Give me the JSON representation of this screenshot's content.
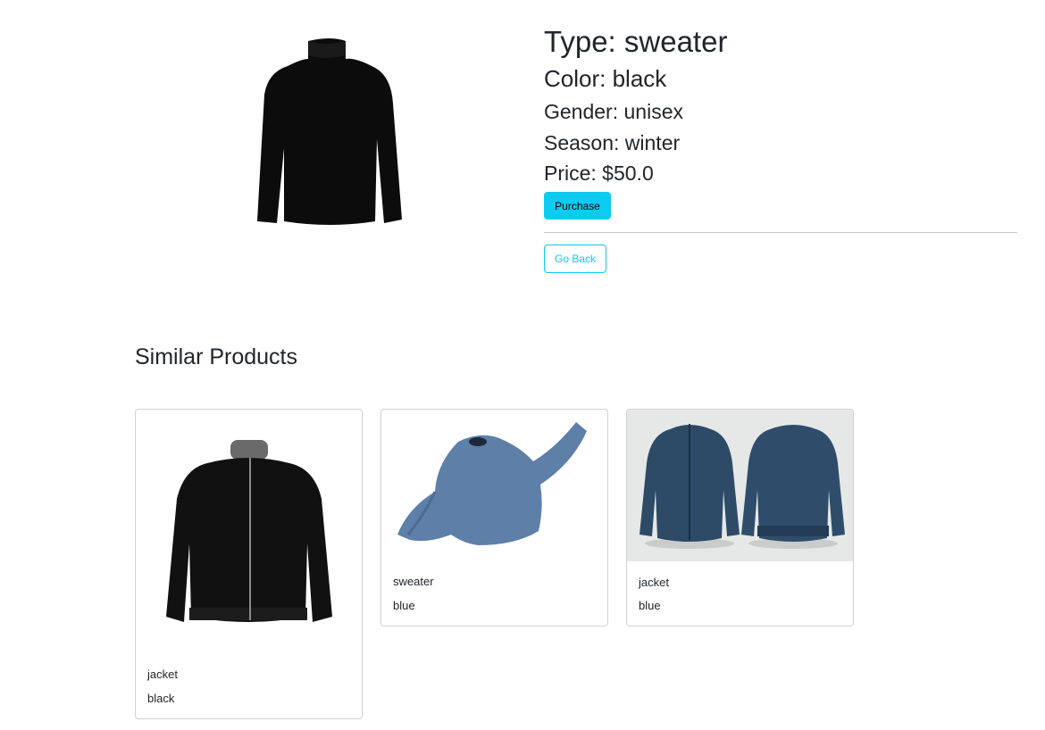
{
  "product": {
    "image_icon": "black-turtleneck-sweater",
    "type": "Type: sweater",
    "color": "Color: black",
    "gender": "Gender: unisex",
    "season": "Season: winter",
    "price": "Price: $50.0"
  },
  "actions": {
    "purchase_label": "Purchase",
    "back_label": "Go Back"
  },
  "colors": {
    "accent": "#0dcaf0",
    "text": "#212529",
    "border": "#d0d0d0"
  },
  "similar": {
    "title": "Similar Products",
    "items": [
      {
        "type": "jacket",
        "color": "black",
        "image_icon": "black-bomber-jacket"
      },
      {
        "type": "sweater",
        "color": "blue",
        "image_icon": "blue-knit-sweater"
      },
      {
        "type": "jacket",
        "color": "blue",
        "image_icon": "navy-bomber-jacket-front-back"
      }
    ]
  }
}
